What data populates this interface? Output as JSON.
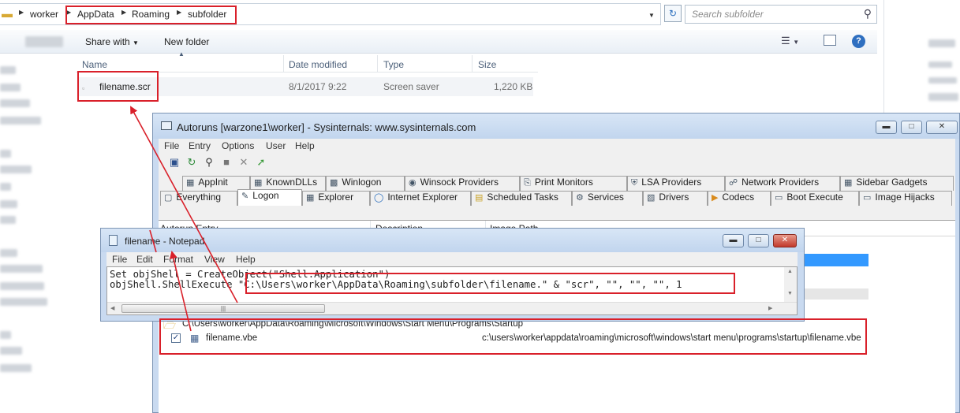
{
  "explorer": {
    "breadcrumb": [
      "worker",
      "AppData",
      "Roaming",
      "subfolder"
    ],
    "search_placeholder": "Search subfolder",
    "toolbar": {
      "share_with": "Share with",
      "new_folder": "New folder"
    },
    "columns": {
      "name": "Name",
      "date_modified": "Date modified",
      "type": "Type",
      "size": "Size"
    },
    "file": {
      "name": "filename.scr",
      "date_modified": "8/1/2017 9:22",
      "type": "Screen saver",
      "size": "1,220 KB"
    }
  },
  "autoruns": {
    "title": "Autoruns [warzone1\\worker] - Sysinternals: www.sysinternals.com",
    "menu": [
      "File",
      "Entry",
      "Options",
      "User",
      "Help"
    ],
    "tabs_row1": [
      "AppInit",
      "KnownDLLs",
      "Winlogon",
      "Winsock Providers",
      "Print Monitors",
      "LSA Providers",
      "Network Providers",
      "Sidebar Gadgets"
    ],
    "tabs_row2": [
      "Everything",
      "Logon",
      "Explorer",
      "Internet Explorer",
      "Scheduled Tasks",
      "Services",
      "Drivers",
      "Codecs",
      "Boot Execute",
      "Image Hijacks"
    ],
    "active_tab": "Logon",
    "columns": {
      "entry": "Autorun Entry",
      "description": "Description",
      "image_path": "Image Path"
    },
    "startup_key": "C:\\Users\\worker\\AppData\\Roaming\\Microsoft\\Windows\\Start Menu\\Programs\\Startup",
    "entry": {
      "name": "filename.vbe",
      "path": "c:\\users\\worker\\appdata\\roaming\\microsoft\\windows\\start menu\\programs\\startup\\filename.vbe"
    }
  },
  "notepad": {
    "title": "filename - Notepad",
    "menu": [
      "File",
      "Edit",
      "Format",
      "View",
      "Help"
    ],
    "line1": "Set objShell = CreateObject(\"Shell.Application\")",
    "line2_prefix": "objShell.ShellExecute ",
    "line2_highlight": "\"C:\\Users\\worker\\AppData\\Roaming\\subfolder\\filename.\" & \"scr\", \"\", \"\", \"\", 1"
  },
  "colors": {
    "annotation": "#d9202a",
    "selection": "#3399ff",
    "title_bar": "#c9daf0"
  }
}
